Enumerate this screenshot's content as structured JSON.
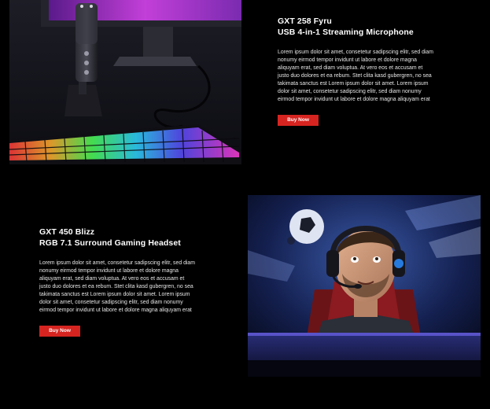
{
  "products": [
    {
      "title_line1": "GXT 258 Fyru",
      "title_line2": "USB 4-in-1 Streaming Microphone",
      "description": "Lorem ipsum dolor sit amet, consetetur sadipscing elitr, sed diam nonumy eirmod tempor invidunt ut labore et dolore magna aliquyam erat, sed diam voluptua. At vero eos et accusam et justo duo dolores et ea rebum. Stet clita kasd gubergren, no sea takimata sanctus est Lorem ipsum dolor sit amet. Lorem ipsum dolor sit amet, consetetur sadipscing elitr, sed diam nonumy eirmod tempor invidunt ut labore et dolore magna aliquyam erat",
      "button_label": "Buy Now",
      "image": "streaming-microphone-photo"
    },
    {
      "title_line1": "GXT 450 Blizz",
      "title_line2": "RGB 7.1 Surround Gaming Headset",
      "description": "Lorem ipsum dolor sit amet, consetetur sadipscing elitr, sed diam nonumy eirmod tempor invidunt ut labore et dolore magna aliquyam erat, sed diam voluptua. At vero eos et accusam et justo duo dolores et ea rebum. Stet clita kasd gubergren, no sea takimata sanctus est Lorem ipsum dolor sit amet. Lorem ipsum dolor sit amet, consetetur sadipscing elitr, sed diam nonumy eirmod tempor invidunt ut labore et dolore magna aliquyam erat",
      "button_label": "Buy Now",
      "image": "gaming-headset-photo"
    }
  ],
  "colors": {
    "page_background": "#000000",
    "button": "#d62420",
    "text": "#ffffff"
  }
}
